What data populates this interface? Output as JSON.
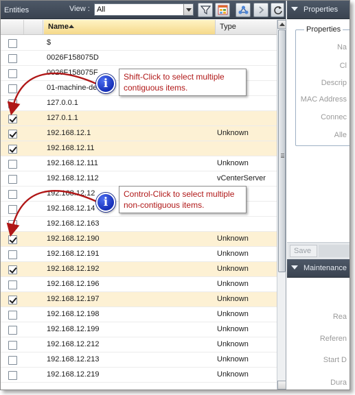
{
  "toolbar": {
    "title": "Entities",
    "view_label": "View :",
    "view_value": "All"
  },
  "grid": {
    "headers": {
      "name": "Name",
      "type": "Type"
    },
    "rows": [
      {
        "name": "$",
        "type": "",
        "checked": false
      },
      {
        "name": "0026F158075D",
        "type": "",
        "checked": false
      },
      {
        "name": "0026F158075F",
        "type": "",
        "checked": false
      },
      {
        "name": "01-machine-de",
        "type": "",
        "checked": false
      },
      {
        "name": "127.0.0.1",
        "type": "",
        "checked": false
      },
      {
        "name": "127.0.1.1",
        "type": "",
        "checked": true
      },
      {
        "name": "192.168.12.1",
        "type": "Unknown",
        "checked": true
      },
      {
        "name": "192.168.12.11",
        "type": "",
        "checked": true
      },
      {
        "name": "192.168.12.111",
        "type": "Unknown",
        "checked": false
      },
      {
        "name": "192.168.12.112",
        "type": "vCenterServer",
        "checked": false
      },
      {
        "name": "192.168.12.12",
        "type": "",
        "checked": false
      },
      {
        "name": "192.168.12.14",
        "type": "",
        "checked": false
      },
      {
        "name": "192.168.12.163",
        "type": "",
        "checked": false
      },
      {
        "name": "192.168.12.190",
        "type": "Unknown",
        "checked": true
      },
      {
        "name": "192.168.12.191",
        "type": "Unknown",
        "checked": false
      },
      {
        "name": "192.168.12.192",
        "type": "Unknown",
        "checked": true
      },
      {
        "name": "192.168.12.196",
        "type": "Unknown",
        "checked": false
      },
      {
        "name": "192.168.12.197",
        "type": "Unknown",
        "checked": true
      },
      {
        "name": "192.168.12.198",
        "type": "Unknown",
        "checked": false
      },
      {
        "name": "192.168.12.199",
        "type": "Unknown",
        "checked": false
      },
      {
        "name": "192.168.12.212",
        "type": "Unknown",
        "checked": false
      },
      {
        "name": "192.168.12.213",
        "type": "Unknown",
        "checked": false
      },
      {
        "name": "192.168.12.219",
        "type": "Unknown",
        "checked": false
      }
    ]
  },
  "properties": {
    "header": "Properties",
    "group_title": "Properties",
    "labels": [
      "Na",
      "Cl",
      "Descrip",
      "MAC Address",
      "Connec",
      "Alle"
    ],
    "save_label": "Save"
  },
  "maintenance": {
    "header": "Maintenance",
    "labels": [
      "Rea",
      "Referen",
      "Start D",
      "Dura"
    ]
  },
  "callouts": {
    "shift_text": "Shift-Click to select multiple contiguous items.",
    "control_text": "Control-Click to select multiple non-contiguous items.",
    "info_glyph": "i"
  },
  "colors": {
    "header_dark": "#3e4755",
    "selected_row": "#fdf1d4",
    "sort_header": "#f5d98a",
    "callout_text": "#b01717",
    "info_blue": "#1e3fd0",
    "arrow_red": "#b01717"
  }
}
